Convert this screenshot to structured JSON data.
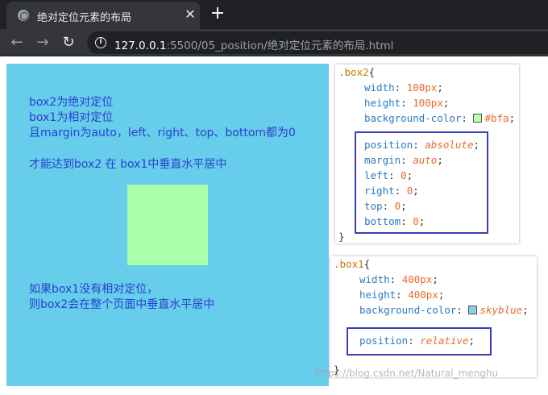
{
  "browser": {
    "tab_title": "绝对定位元素的布局",
    "tab_close": "✕",
    "new_tab": "+",
    "url_host": "127.0.0.1",
    "url_path": ":5500/05_position/绝对定位元素的布局.html",
    "back_icon": "←",
    "forward_icon": "→",
    "reload_icon": "↻"
  },
  "page": {
    "notes_top": [
      "box2为绝对定位",
      "box1为相对定位",
      "且margin为auto，left、right、top、bottom都为0",
      "",
      "才能达到box2 在 box1中垂直水平居中"
    ],
    "notes_bottom": [
      "如果box1没有相对定位，",
      "则box2会在整个页面中垂直水平居中"
    ]
  },
  "devtools": {
    "box2_rule": {
      "selector": ".box2",
      "width_prop": "width",
      "width_val": "100px",
      "height_prop": "height",
      "height_val": "100px",
      "bg_prop": "background-color",
      "bg_val": "#bfa",
      "position_prop": "position",
      "position_val": "absolute",
      "margin_prop": "margin",
      "margin_val": "auto",
      "left_prop": "left",
      "left_val": "0",
      "right_prop": "right",
      "right_val": "0",
      "top_prop": "top",
      "top_val": "0",
      "bottom_prop": "bottom",
      "bottom_val": "0"
    },
    "box1_rule": {
      "selector": ".box1",
      "width_prop": "width",
      "width_val": "400px",
      "height_prop": "height",
      "height_val": "400px",
      "bg_prop": "background-color",
      "bg_val": "skyblue",
      "position_prop": "position",
      "position_val": "relative"
    }
  },
  "watermark": "https://blog.csdn.net/Natural_menghu",
  "colors": {
    "box1": "#66cdea",
    "box2": "#aaffaa",
    "note_text": "#2b3fd0",
    "highlight_border": "#3a3fb8"
  }
}
